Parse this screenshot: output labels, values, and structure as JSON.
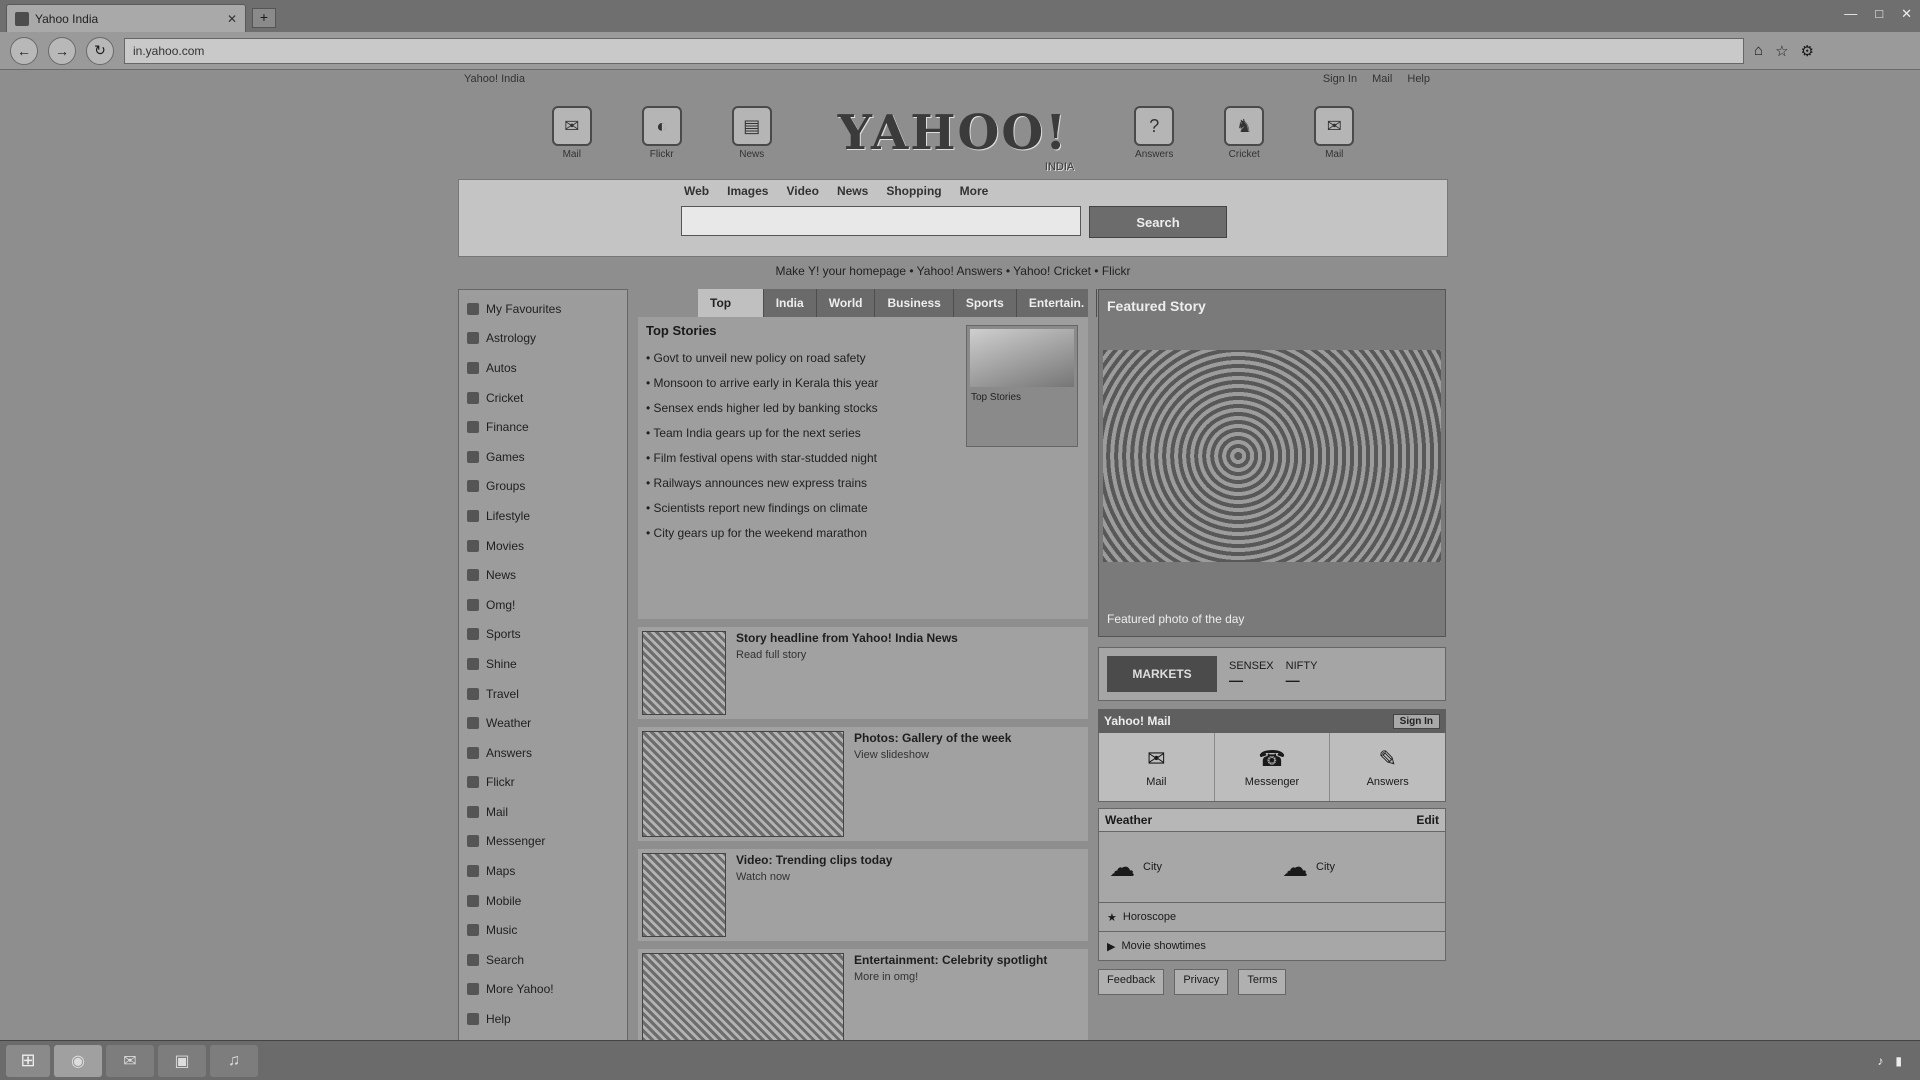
{
  "browser": {
    "tab_title": "Yahoo India",
    "new_tab": "+",
    "address": "in.yahoo.com",
    "window_controls": [
      "—",
      "□",
      "✕"
    ]
  },
  "topbar": {
    "left": "Yahoo! India",
    "right": [
      "Sign In",
      "Mail",
      "Help"
    ]
  },
  "header": {
    "left_icons": [
      {
        "icon": "mail-icon",
        "label": "Mail",
        "glyph": "✉"
      },
      {
        "icon": "flickr-icon",
        "label": "Flickr",
        "glyph": "◐"
      },
      {
        "icon": "news-icon",
        "label": "News",
        "glyph": "▤"
      }
    ],
    "logo": "YAHOO!",
    "logo_sub": "INDIA",
    "right_icons": [
      {
        "icon": "answers-icon",
        "label": "Answers",
        "glyph": "?"
      },
      {
        "icon": "cricket-icon",
        "label": "Cricket",
        "glyph": "♞"
      },
      {
        "icon": "messenger-icon",
        "label": "Mail",
        "glyph": "✉"
      }
    ]
  },
  "search": {
    "tabs": [
      "Web",
      "Images",
      "Video",
      "News",
      "Shopping",
      "More"
    ],
    "placeholder": "",
    "button": "Search"
  },
  "promo": "Make Y! your homepage  •  Yahoo! Answers  •  Yahoo! Cricket  •  Flickr",
  "sidebar": {
    "items": [
      "My Favourites",
      "Astrology",
      "Autos",
      "Cricket",
      "Finance",
      "Games",
      "Groups",
      "Lifestyle",
      "Movies",
      "News",
      "Omg!",
      "Sports",
      "Shine",
      "Travel",
      "Weather",
      "Answers",
      "Flickr",
      "Mail",
      "Messenger",
      "Maps",
      "Mobile",
      "Music",
      "Search",
      "More Yahoo!",
      "Help"
    ]
  },
  "news": {
    "tabs": [
      "Top Stories",
      "India",
      "World",
      "Business",
      "Sports",
      "Entertain."
    ],
    "active_tab": 0,
    "story_title": "Top Stories",
    "headlines": [
      "Govt to unveil new policy on road safety",
      "Monsoon to arrive early in Kerala this year",
      "Sensex ends higher led by banking stocks",
      "Team India gears up for the next series",
      "Film festival opens with star-studded night",
      "Railways announces new express trains",
      "Scientists report new findings on climate",
      "City gears up for the weekend marathon"
    ],
    "thumb_caption": "Top Stories"
  },
  "feed": [
    {
      "title": "Story headline from Yahoo! India News",
      "sub": "Read full story"
    },
    {
      "title": "Photos: Gallery of the week",
      "sub": "View slideshow"
    },
    {
      "title": "Video: Trending clips today",
      "sub": "Watch now"
    },
    {
      "title": "Entertainment: Celebrity spotlight",
      "sub": "More in omg!"
    }
  ],
  "hero": {
    "title": "Featured Story",
    "caption": "Featured photo of the day"
  },
  "markets": {
    "badge": "MARKETS",
    "items": [
      {
        "name": "SENSEX",
        "value": "—"
      },
      {
        "name": "NIFTY",
        "value": "—"
      }
    ]
  },
  "shortcuts": {
    "title": "Yahoo! Mail",
    "action": "Sign In",
    "items": [
      {
        "icon": "mail-icon",
        "glyph": "✉",
        "label": "Mail"
      },
      {
        "icon": "chat-icon",
        "glyph": "☎",
        "label": "Messenger"
      },
      {
        "icon": "answers-icon",
        "glyph": "✎",
        "label": "Answers"
      }
    ]
  },
  "weather": {
    "title": "Weather",
    "action": "Edit",
    "cities": [
      {
        "icon": "cloud-icon",
        "glyph": "☁",
        "city": "City"
      },
      {
        "icon": "cloud-icon",
        "glyph": "☁",
        "city": "City"
      }
    ]
  },
  "extras": [
    "Horoscope",
    "Movie showtimes"
  ],
  "bottom_links": [
    "Feedback",
    "Privacy",
    "Terms"
  ],
  "taskbar": {
    "start": "⊞",
    "items": [
      "◉",
      "✉",
      "▣",
      "♫"
    ],
    "clock": ""
  }
}
